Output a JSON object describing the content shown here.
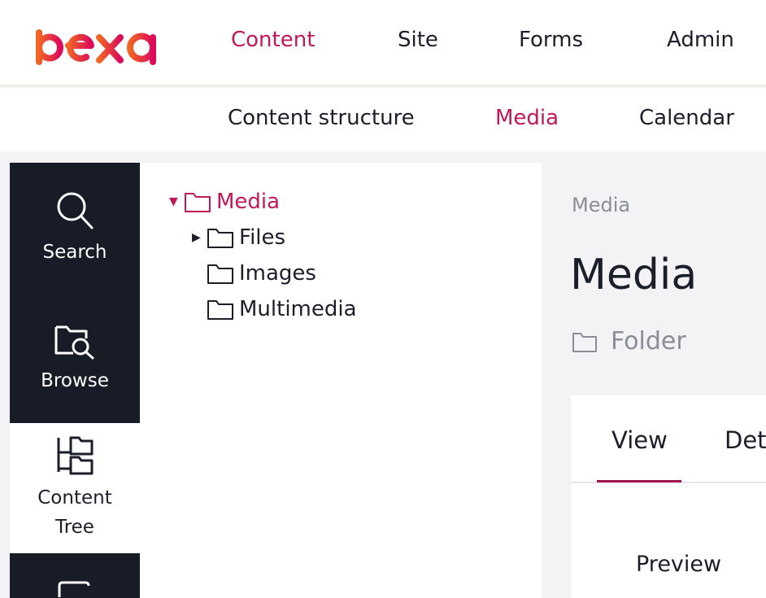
{
  "brand": {
    "logo_text": "ibexa",
    "logo_color_start": "#f26522",
    "logo_color_end": "#db0a5b"
  },
  "colors": {
    "accent": "#c2185b",
    "sidebar_dark": "#171c26",
    "muted": "#8a8e96"
  },
  "main_nav": {
    "items": [
      {
        "label": "Content",
        "active": true
      },
      {
        "label": "Site"
      },
      {
        "label": "Forms"
      },
      {
        "label": "Admin"
      }
    ]
  },
  "sub_nav": {
    "items": [
      {
        "label": "Content structure"
      },
      {
        "label": "Media",
        "active": true
      },
      {
        "label": "Calendar"
      }
    ]
  },
  "side_tools": [
    {
      "label": "Search",
      "icon": "search-icon"
    },
    {
      "label": "Browse",
      "icon": "browse-folder-icon"
    },
    {
      "label_line1": "Content",
      "label_line2": "Tree",
      "icon": "content-tree-icon",
      "active": true
    },
    {
      "label": "",
      "icon": "bookmark-icon"
    }
  ],
  "tree": {
    "root": {
      "label": "Media",
      "expanded": true,
      "icon": "folder-icon"
    },
    "children": [
      {
        "label": "Files",
        "collapsed": true,
        "icon": "folder-icon"
      },
      {
        "label": "Images",
        "icon": "folder-icon"
      },
      {
        "label": "Multimedia",
        "icon": "folder-icon"
      }
    ]
  },
  "content": {
    "breadcrumb": "Media",
    "title": "Media",
    "content_type": "Folder",
    "tabs": [
      {
        "label": "View",
        "active": true
      },
      {
        "label": "Det"
      }
    ],
    "section_label": "Preview"
  }
}
